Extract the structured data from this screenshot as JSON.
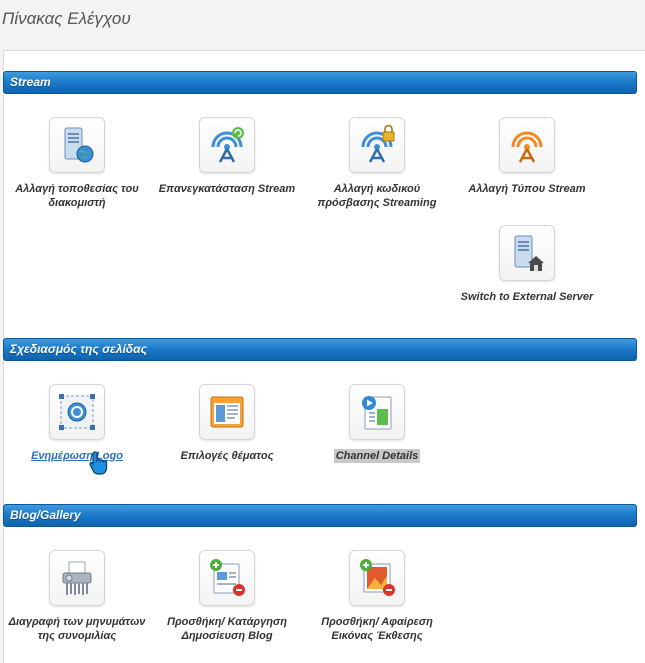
{
  "page_title": "Πίνακας Ελέγχου",
  "sections": {
    "stream": {
      "title": "Stream",
      "items": [
        {
          "label": "Αλλαγή τοποθεσίας του διακομιστή",
          "icon": "server-globe-icon"
        },
        {
          "label": "Επανεγκατάσταση Stream",
          "icon": "antenna-refresh-icon"
        },
        {
          "label": "Αλλαγή κωδικού πρόσβασης Streaming",
          "icon": "antenna-lock-icon"
        },
        {
          "label": "Αλλαγή Τύπου Stream",
          "icon": "antenna-orange-icon"
        },
        {
          "label": "Switch to External Server",
          "icon": "server-home-icon"
        }
      ]
    },
    "design": {
      "title": "Σχεδιασμός της σελίδας",
      "items": [
        {
          "label": "Ενημέρωση Logo",
          "icon": "logo-frame-icon"
        },
        {
          "label": "Επιλογές θέματος",
          "icon": "theme-window-icon"
        },
        {
          "label": "Channel Details",
          "icon": "channel-video-icon"
        }
      ]
    },
    "blog": {
      "title": "Blog/Gallery",
      "items": [
        {
          "label": "Διαγραφή των μηνυμάτων της συνομιλίας",
          "icon": "shredder-icon"
        },
        {
          "label": "Προσθήκη/ Κατάργηση Δημοσίευση Blog",
          "icon": "blog-add-remove-icon"
        },
        {
          "label": "Προσθήκη/ Αφαίρεση Εικόνας Έκθεσης",
          "icon": "image-add-remove-icon"
        }
      ]
    }
  },
  "colors": {
    "section_bar": "#1a79c9",
    "link": "#2a6ebd",
    "antenna_blue": "#3d8fd8",
    "antenna_orange": "#f08a24"
  }
}
